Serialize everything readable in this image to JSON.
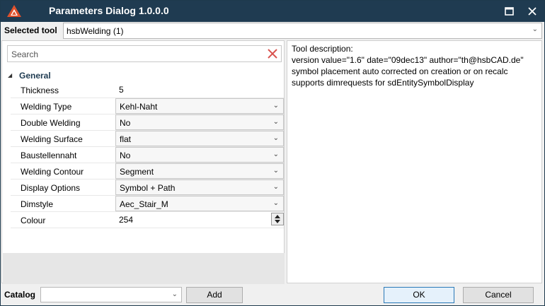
{
  "window": {
    "title": "Parameters Dialog 1.0.0.0"
  },
  "tool": {
    "label": "Selected tool",
    "value": "hsbWelding (1)"
  },
  "search": {
    "placeholder": "Search"
  },
  "group": {
    "label": "General"
  },
  "properties": [
    {
      "name": "Thickness",
      "value": "5",
      "kind": "text"
    },
    {
      "name": "Welding Type",
      "value": "Kehl-Naht",
      "kind": "dropdown"
    },
    {
      "name": "Double Welding",
      "value": "No",
      "kind": "dropdown"
    },
    {
      "name": "Welding Surface",
      "value": "flat",
      "kind": "dropdown"
    },
    {
      "name": "Baustellennaht",
      "value": "No",
      "kind": "dropdown"
    },
    {
      "name": "Welding Contour",
      "value": "Segment",
      "kind": "dropdown"
    },
    {
      "name": "Display Options",
      "value": "Symbol + Path",
      "kind": "dropdown"
    },
    {
      "name": "Dimstyle",
      "value": "Aec_Stair_M",
      "kind": "dropdown"
    },
    {
      "name": "Colour",
      "value": "254",
      "kind": "spinner"
    }
  ],
  "description": {
    "heading": "Tool description:",
    "lines": [
      "version value=\"1.6\" date=\"09dec13\" author=\"th@hsbCAD.de\"",
      "symbol placement auto corrected on creation or on recalc",
      "supports dimrequests for sdEntitySymbolDisplay"
    ]
  },
  "catalog": {
    "label": "Catalog",
    "value": ""
  },
  "buttons": {
    "add": "Add",
    "ok": "OK",
    "cancel": "Cancel"
  },
  "colors": {
    "titlebar": "#1f3b51",
    "accent": "#2a7ab8",
    "clear_icon": "#d9534f",
    "app_icon": "#e0522d"
  }
}
